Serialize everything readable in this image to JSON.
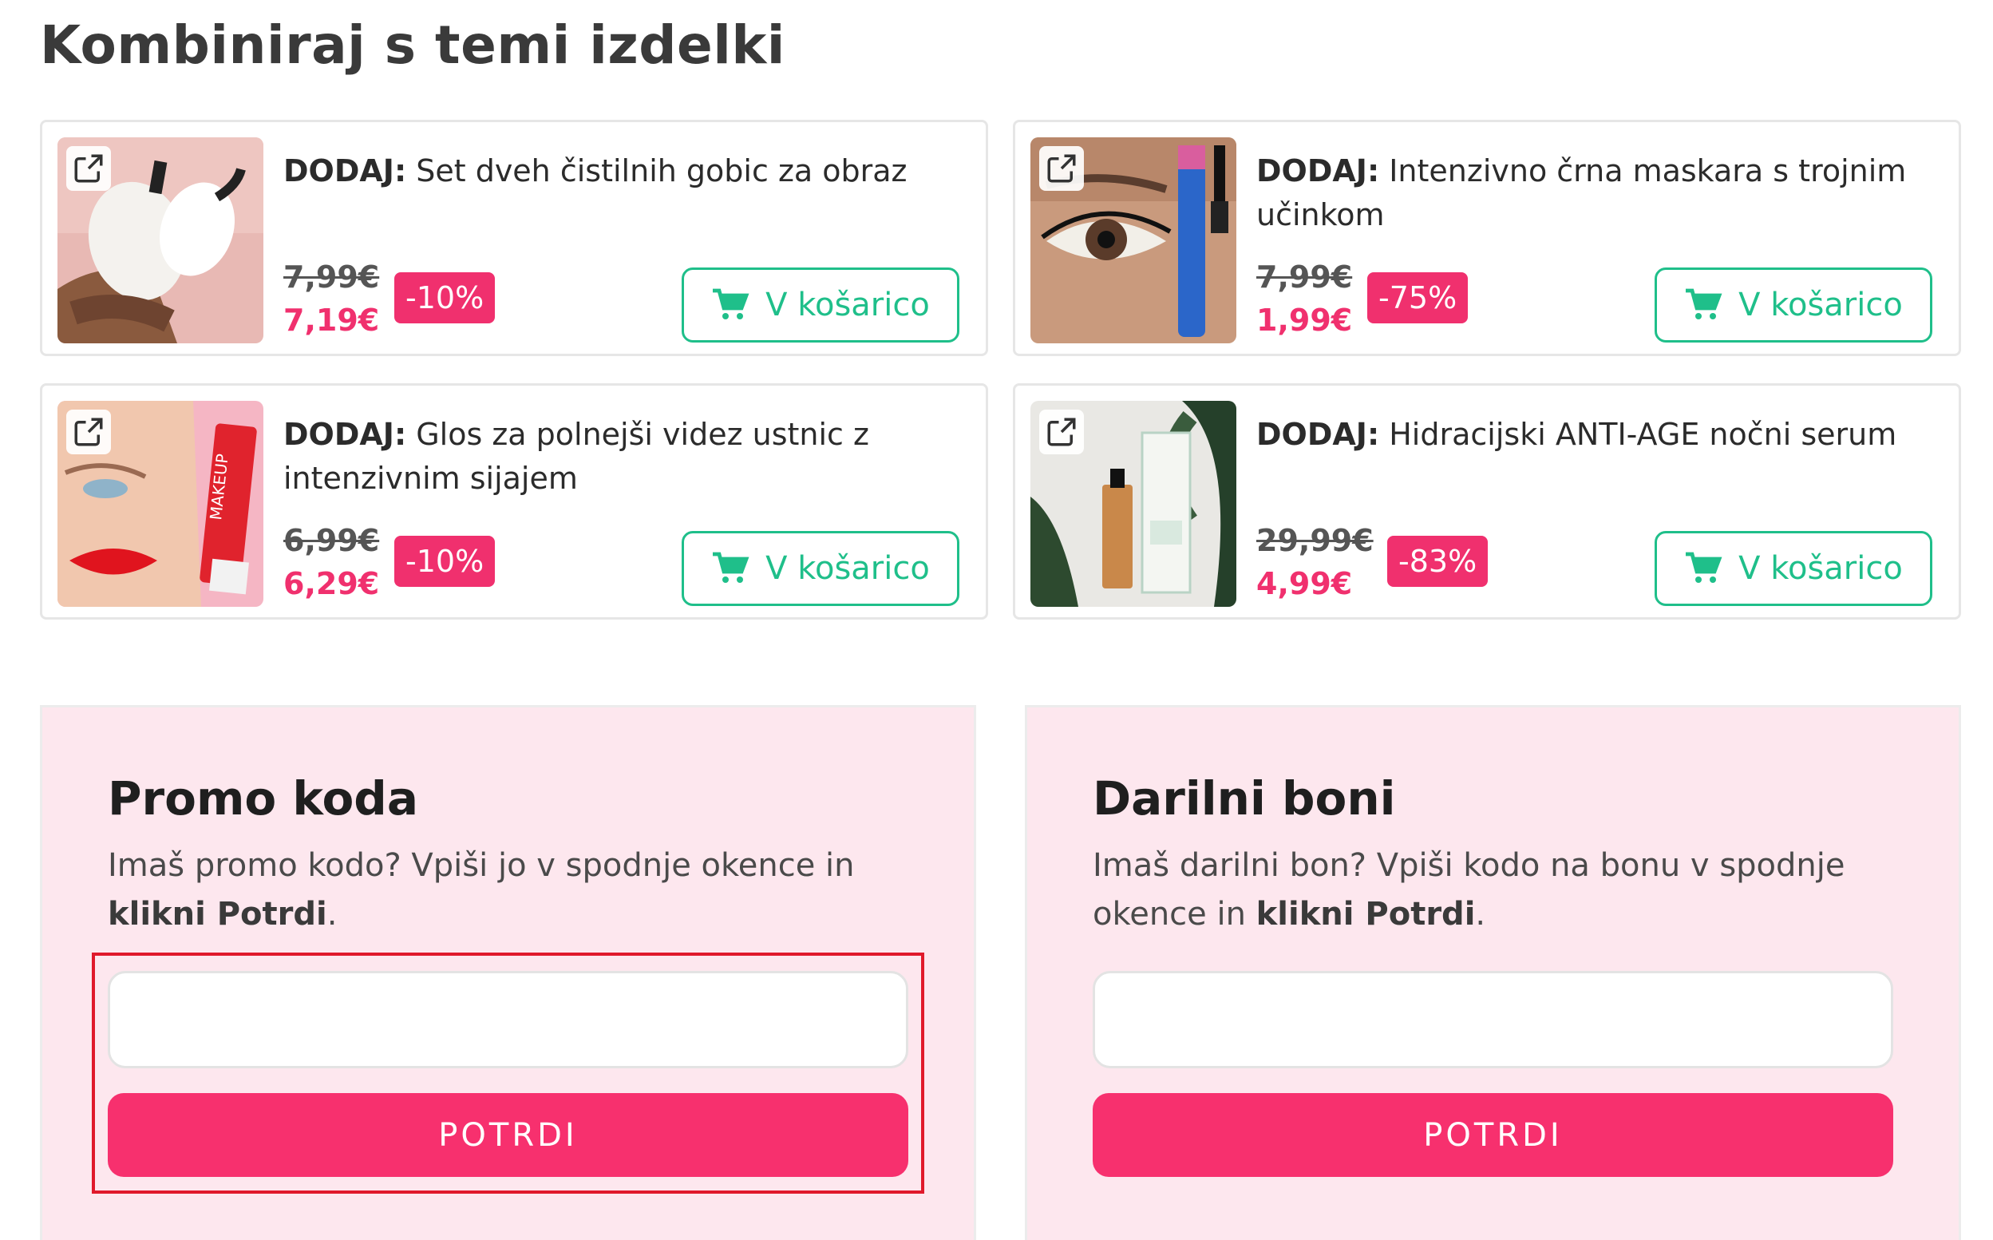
{
  "title": "Kombiniraj s temi izdelki",
  "products": [
    {
      "prefix": "DODAJ:",
      "name": " Set dveh čistilnih gobic za obraz",
      "old_price": "7,99€",
      "new_price": "7,19€",
      "discount": "-10%",
      "cart_label": "V košarico",
      "image": "sponges"
    },
    {
      "prefix": "DODAJ:",
      "name": " Intenzivno črna maskara s trojnim učinkom",
      "old_price": "7,99€",
      "new_price": "1,99€",
      "discount": "-75%",
      "cart_label": "V košarico",
      "image": "mascara"
    },
    {
      "prefix": "DODAJ:",
      "name": " Glos za polnejši videz ustnic z intenzivnim sijajem",
      "old_price": "6,99€",
      "new_price": "6,29€",
      "discount": "-10%",
      "cart_label": "V košarico",
      "image": "lipgloss"
    },
    {
      "prefix": "DODAJ:",
      "name": " Hidracijski ANTI-AGE nočni serum",
      "old_price": "29,99€",
      "new_price": "4,99€",
      "discount": "-83%",
      "cart_label": "V košarico",
      "image": "serum"
    }
  ],
  "promo": {
    "title": "Promo koda",
    "desc_text": "Imaš promo kodo? Vpiši jo v spodnje okence in ",
    "desc_bold": "klikni Potrdi",
    "desc_end": ".",
    "input_value": "",
    "button_label": "POTRDI"
  },
  "gift": {
    "title": "Darilni boni",
    "desc_text": "Imaš darilni bon? Vpiši kodo na bonu v spodnje okence in ",
    "desc_bold": "klikni Potrdi",
    "desc_end": ".",
    "input_value": "",
    "button_label": "POTRDI"
  },
  "colors": {
    "accent": "#f0306e",
    "cart": "#1fbf8a",
    "panel_bg": "#fde7ee",
    "highlight": "#e0192b"
  }
}
